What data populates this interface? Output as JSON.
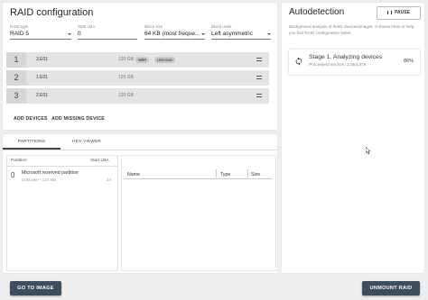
{
  "header": {
    "title": "RAID configuration",
    "raid_type_label": "RAID type",
    "raid_type_value": "RAID 5",
    "start_lba_label": "Start LBA",
    "start_lba_value": "0",
    "block_size_label": "Block size",
    "block_size_value": "64 KB (most freque...",
    "block_order_label": "Block order",
    "block_order_value": "Left asymmetric"
  },
  "devices": [
    {
      "index": "1",
      "name": "3.E01",
      "size": "120 GB",
      "tags": [
        "MBR",
        "Unknown"
      ]
    },
    {
      "index": "2",
      "name": "1.E01",
      "size": "120 GB",
      "tags": []
    },
    {
      "index": "3",
      "name": "2.E01",
      "size": "120 GB",
      "tags": []
    }
  ],
  "device_actions": {
    "add_device": "ADD DEVICES",
    "add_missing": "ADD MISSING DEVICE"
  },
  "tabs": [
    {
      "label": "PARTITIONS",
      "active": true
    },
    {
      "label": "HEX VIEWER",
      "active": false
    }
  ],
  "partitions": {
    "col_partition": "Partition",
    "col_start_lba": "Start LBA",
    "items": [
      {
        "index": "0",
        "name": "Microsoft reserved partition",
        "detail": "Unknown · 134 MB",
        "start_lba": "34"
      }
    ]
  },
  "properties": {
    "col_name": "Name",
    "col_type": "Type",
    "col_size": "Size"
  },
  "autodetection": {
    "title": "Autodetection",
    "pause_label": "PAUSE",
    "description": "Background analysis of RAID devices/images. It shows hints to help you find RAID configuration faster.",
    "stage_title": "Stage 1. Analyzing devices",
    "stage_sub": "Processed sectors: 2,584,576",
    "progress": "86%"
  },
  "footer": {
    "go_to_image": "GO TO IMAGE",
    "unmount_raid": "UNMOUNT RAID"
  },
  "colors": {
    "primary_dark": "#3e4e5c",
    "row_bg": "#e3e3e3",
    "index_bg": "#d6d6d6"
  }
}
